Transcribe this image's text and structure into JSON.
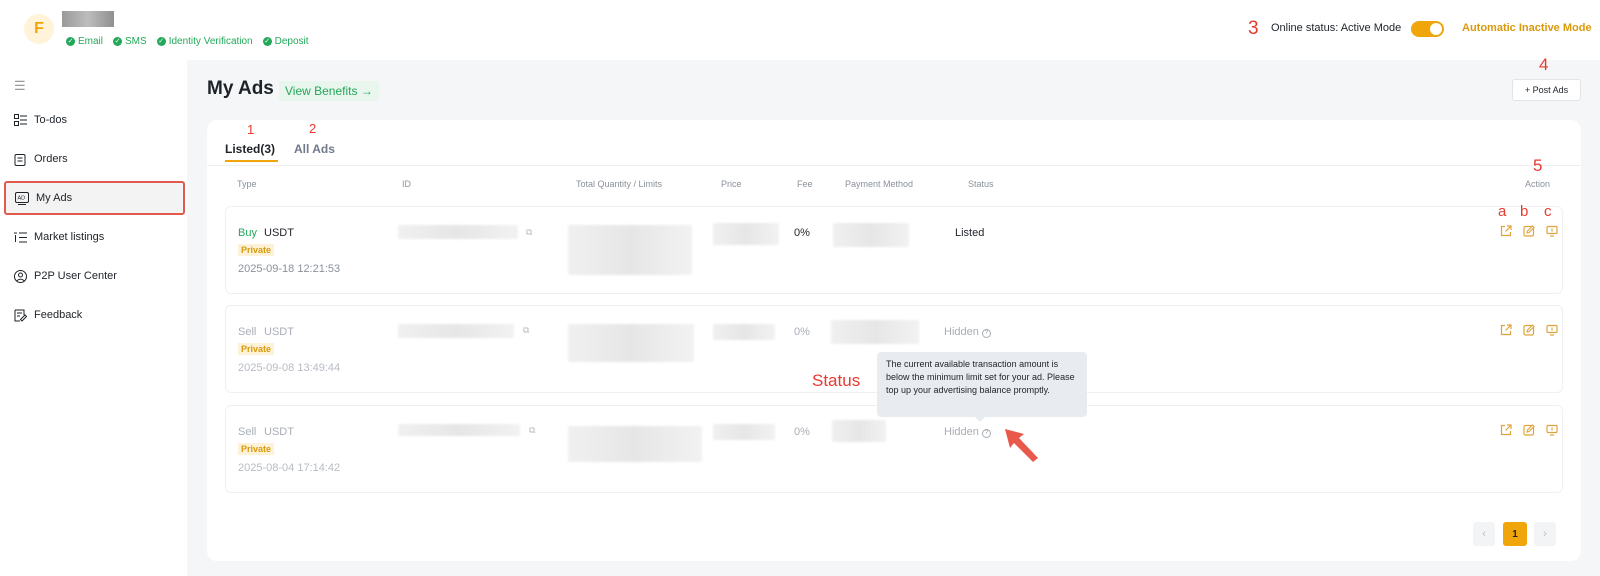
{
  "header": {
    "avatar_letter": "F",
    "verifications": [
      "Email",
      "SMS",
      "Identity Verification",
      "Deposit"
    ],
    "online_status": "Online status: Active Mode",
    "auto_inactive": "Automatic Inactive Mode"
  },
  "sidebar": {
    "items": [
      {
        "label": "To-dos",
        "icon": "todo-list-icon"
      },
      {
        "label": "Orders",
        "icon": "clipboard-icon"
      },
      {
        "label": "My Ads",
        "icon": "ad-icon"
      },
      {
        "label": "Market listings",
        "icon": "list-icon"
      },
      {
        "label": "P2P User Center",
        "icon": "user-circle-icon"
      },
      {
        "label": "Feedback",
        "icon": "feedback-icon"
      }
    ],
    "active_index": 2
  },
  "main": {
    "title": "My Ads",
    "view_benefits": "View Benefits →",
    "post_ads": "+ Post Ads",
    "tabs": [
      "Listed(3)",
      "All Ads"
    ],
    "columns": [
      "Type",
      "ID",
      "Total Quantity / Limits",
      "Price",
      "Fee",
      "Payment Method",
      "Status",
      "Action"
    ],
    "rows": [
      {
        "side": "Buy",
        "coin": "USDT",
        "tag": "Private",
        "date": "2025-09-18 12:21:53",
        "fee": "0%",
        "status": "Listed"
      },
      {
        "side": "Sell",
        "coin": "USDT",
        "tag": "Private",
        "date": "2025-09-08 13:49:44",
        "fee": "0%",
        "status": "Hidden"
      },
      {
        "side": "Sell",
        "coin": "USDT",
        "tag": "Private",
        "date": "2025-08-04 17:14:42",
        "fee": "0%",
        "status": "Hidden"
      }
    ],
    "tooltip": "The current available transaction amount is below the minimum limit set for your ad. Please top up your advertising balance promptly.",
    "pager": {
      "prev": "‹",
      "current": "1",
      "next": "›"
    }
  },
  "annotations": {
    "tab_listed": "1",
    "tab_all": "2",
    "online": "3",
    "post": "4",
    "action": "5",
    "a": "a",
    "b": "b",
    "c": "c",
    "status": "Status"
  },
  "colors": {
    "accent": "#f0a50a",
    "buy": "#23a85a",
    "annotation": "#e63a2e"
  }
}
